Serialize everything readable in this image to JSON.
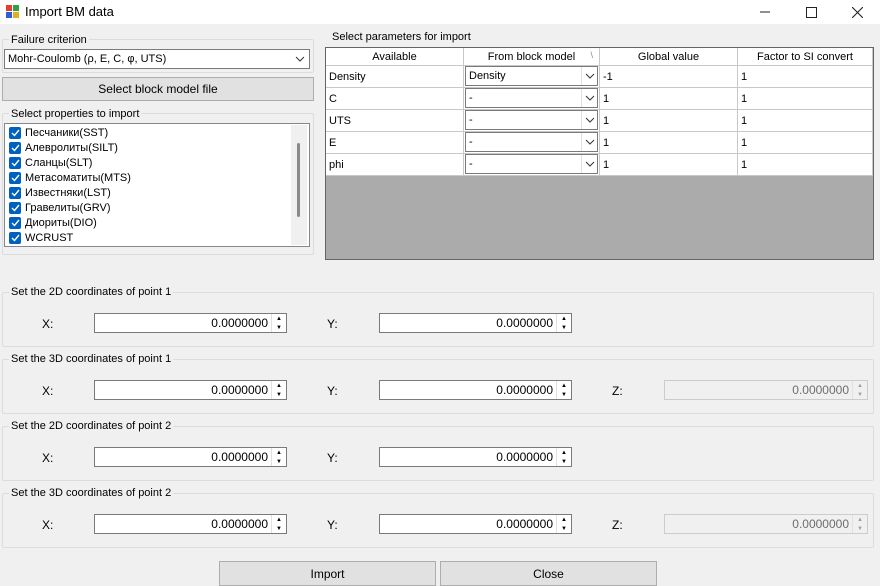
{
  "window": {
    "title": "Import BM data"
  },
  "failure_criterion": {
    "label": "Failure criterion",
    "selected": "Mohr-Coulomb (ρ, E, C, φ, UTS)"
  },
  "select_file_button": "Select block model file",
  "properties": {
    "label": "Select properties to import",
    "items": [
      "Песчаники(SST)",
      "Алевролиты(SILT)",
      "Сланцы(SLT)",
      "Метасоматиты(MTS)",
      "Известняки(LST)",
      "Гравелиты(GRV)",
      "Диориты(DIO)",
      "WCRUST"
    ]
  },
  "parameters": {
    "label": "Select parameters for import",
    "columns": [
      "Available",
      "From block model",
      "Global value",
      "Factor to SI convert"
    ],
    "rows": [
      {
        "available": "Density",
        "from_block": "Density",
        "global": "-1",
        "factor": "1"
      },
      {
        "available": "C",
        "from_block": "-",
        "global": "1",
        "factor": "1"
      },
      {
        "available": "UTS",
        "from_block": "-",
        "global": "1",
        "factor": "1"
      },
      {
        "available": "E",
        "from_block": "-",
        "global": "1",
        "factor": "1"
      },
      {
        "available": "phi",
        "from_block": "-",
        "global": "1",
        "factor": "1"
      }
    ]
  },
  "coords": [
    {
      "title": "Set the 2D coordinates of point 1",
      "x_label": "X:",
      "y_label": "Y:",
      "x": "0.0000000",
      "y": "0.0000000"
    },
    {
      "title": "Set the 3D coordinates of point 1",
      "x_label": "X:",
      "y_label": "Y:",
      "z_label": "Z:",
      "x": "0.0000000",
      "y": "0.0000000",
      "z": "0.0000000"
    },
    {
      "title": "Set the 2D coordinates of point 2",
      "x_label": "X:",
      "y_label": "Y:",
      "x": "0.0000000",
      "y": "0.0000000"
    },
    {
      "title": "Set the 3D coordinates of point 2",
      "x_label": "X:",
      "y_label": "Y:",
      "z_label": "Z:",
      "x": "0.0000000",
      "y": "0.0000000",
      "z": "0.0000000"
    }
  ],
  "buttons": {
    "import": "Import",
    "close": "Close"
  }
}
